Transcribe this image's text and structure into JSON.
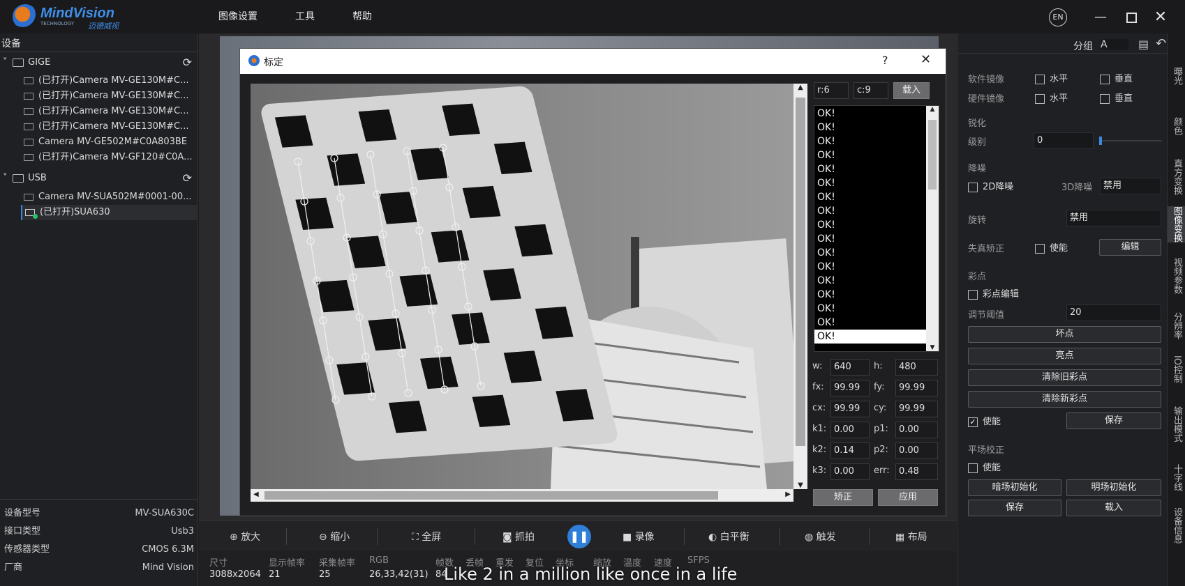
{
  "app": {
    "logo_text": "MindVision",
    "logo_sub": "TECHNOLOGY",
    "logo_cn": "迈德威视"
  },
  "menu": [
    "图像设置",
    "工具",
    "帮助"
  ],
  "window": {
    "lang": "EN"
  },
  "left": {
    "section_title": "设备",
    "groups": [
      {
        "name": "GIGE",
        "items": [
          "(已打开)Camera MV-GE130M#C...",
          "(已打开)Camera MV-GE130M#C...",
          "(已打开)Camera MV-GE130M#C...",
          "(已打开)Camera MV-GE130M#C...",
          "Camera MV-GE502M#C0A803BE",
          "(已打开)Camera MV-GF120#C0A..."
        ]
      },
      {
        "name": "USB",
        "items": [
          "Camera MV-SUA502M#0001-00...",
          "(已打开)SUA630"
        ]
      }
    ],
    "props": [
      {
        "label": "设备型号",
        "value": "MV-SUA630C"
      },
      {
        "label": "接口类型",
        "value": "Usb3"
      },
      {
        "label": "传感器类型",
        "value": "CMOS 6.3M"
      },
      {
        "label": "厂商",
        "value": "Mind Vision"
      }
    ]
  },
  "dialog": {
    "title": "标定",
    "help": "?",
    "r": "r:6",
    "c": "c:9",
    "load": "载入",
    "ok_items": [
      "OK!",
      "OK!",
      "OK!",
      "OK!",
      "OK!",
      "OK!",
      "OK!",
      "OK!",
      "OK!",
      "OK!",
      "OK!",
      "OK!",
      "OK!",
      "OK!",
      "OK!",
      "OK!",
      "OK!"
    ],
    "params": [
      {
        "l1": "w:",
        "v1": "640",
        "l2": "h:",
        "v2": "480"
      },
      {
        "l1": "fx:",
        "v1": "99.99",
        "l2": "fy:",
        "v2": "99.99"
      },
      {
        "l1": "cx:",
        "v1": "99.99",
        "l2": "cy:",
        "v2": "99.99"
      },
      {
        "l1": "k1:",
        "v1": "0.00",
        "l2": "p1:",
        "v2": "0.00"
      },
      {
        "l1": "k2:",
        "v1": "0.14",
        "l2": "p2:",
        "v2": "0.00"
      },
      {
        "l1": "k3:",
        "v1": "0.00",
        "l2": "err:",
        "v2": "0.48"
      }
    ],
    "correct": "矫正",
    "apply": "应用"
  },
  "toolbar": [
    "放大",
    "缩小",
    "全屏",
    "抓拍",
    "录像",
    "白平衡",
    "触发",
    "布局"
  ],
  "status": {
    "headers": [
      "尺寸",
      "显示帧率",
      "采集帧率",
      "RGB",
      "帧数",
      "丢帧",
      "重发",
      "复位",
      "坐标",
      "缩放",
      "温度",
      "速度",
      "SFPS"
    ],
    "values": [
      "3088x2064",
      "21",
      "25",
      "26,33,42(31)",
      "84"
    ]
  },
  "subtitle": "Like 2 in a million like once in a life",
  "right": {
    "group_label": "分组",
    "group_value": "A",
    "soft_mirror": "软件镜像",
    "hard_mirror": "硬件镜像",
    "horizontal": "水平",
    "vertical": "垂直",
    "sharpen": "锐化",
    "level": "级别",
    "level_value": "0",
    "denoise": "降噪",
    "d2": "2D降噪",
    "d3": "3D降噪",
    "disabled": "禁用",
    "rotate": "旋转",
    "rotate_value": "禁用",
    "distortion": "失真矫正",
    "enable": "使能",
    "edit": "编辑",
    "color_point": "彩点",
    "cp_edit": "彩点编辑",
    "threshold": "调节阈值",
    "threshold_value": "20",
    "bad_point": "坏点",
    "bright_point": "亮点",
    "clear_old": "清除旧彩点",
    "clear_new": "清除新彩点",
    "save": "保存",
    "flat": "平场校正",
    "dark_init": "暗场初始化",
    "bright_init": "明场初始化",
    "load": "载入"
  },
  "vtabs": [
    "曝光",
    "颜色",
    "直方变换",
    "图像变换",
    "视频参数",
    "分辨率",
    "IO控制",
    "输出模式",
    "十字线",
    "设备信息"
  ]
}
